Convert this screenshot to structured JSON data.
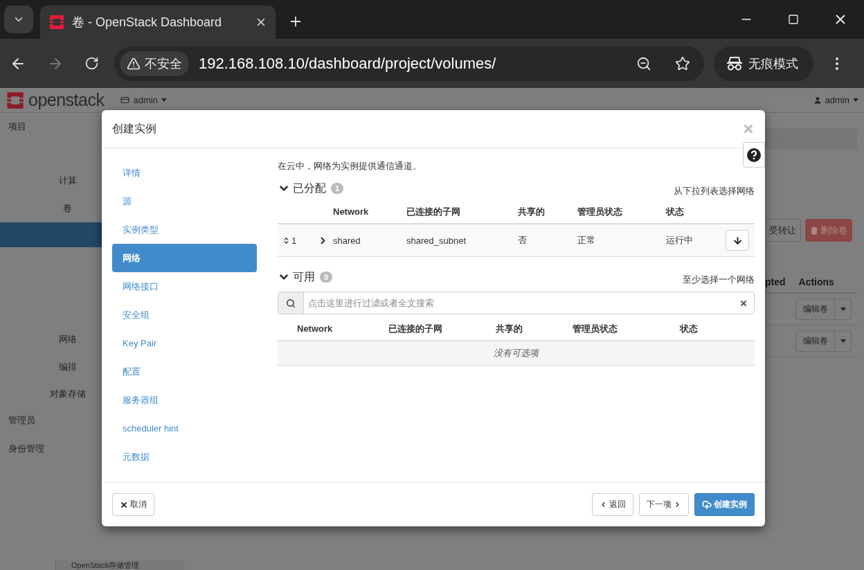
{
  "browser": {
    "tab_title": "卷 - OpenStack Dashboard",
    "security_label": "不安全",
    "url": "192.168.108.10/dashboard/project/volumes/",
    "incognito_label": "无痕模式"
  },
  "header": {
    "logo_text": "openstack",
    "project": "admin",
    "user": "admin"
  },
  "sidebar": {
    "items": [
      {
        "label": "项目",
        "kind": "section"
      },
      {
        "label": "计算",
        "kind": "sub"
      },
      {
        "label": "卷",
        "kind": "sub"
      },
      {
        "label": "网络",
        "kind": "sub"
      },
      {
        "label": "编排",
        "kind": "sub"
      },
      {
        "label": "对象存储",
        "kind": "sub"
      },
      {
        "label": "管理员",
        "kind": "section"
      },
      {
        "label": "身份管理",
        "kind": "section"
      }
    ]
  },
  "background": {
    "buttons": [
      {
        "label": "受转让",
        "kind": "default"
      },
      {
        "label": "删除卷",
        "kind": "danger"
      }
    ],
    "columns": [
      "pted",
      "Actions"
    ],
    "rows": [
      {
        "action": "编辑卷"
      },
      {
        "action": "编辑卷"
      }
    ],
    "bottom_item": "OpenStack存储管理"
  },
  "modal": {
    "title": "创建实例",
    "steps": [
      {
        "label": "详情",
        "selected": false
      },
      {
        "label": "源",
        "selected": false
      },
      {
        "label": "实例类型",
        "selected": false
      },
      {
        "label": "网络",
        "selected": true
      },
      {
        "label": "网络接口",
        "selected": false
      },
      {
        "label": "安全组",
        "selected": false
      },
      {
        "label": "Key Pair",
        "selected": false
      },
      {
        "label": "配置",
        "selected": false
      },
      {
        "label": "服务器组",
        "selected": false
      },
      {
        "label": "scheduler hint",
        "selected": false
      },
      {
        "label": "元数据",
        "selected": false
      }
    ],
    "intro": "在云中，网络为实例提供通信通道。",
    "allocated": {
      "title": "已分配",
      "count": "1",
      "hint": "从下拉列表选择网络",
      "expanded": true,
      "columns": [
        "Network",
        "已连接的子网",
        "共享的",
        "管理员状态",
        "状态"
      ],
      "rows": [
        {
          "order": "1",
          "network": "shared",
          "subnet": "shared_subnet",
          "shared": "否",
          "admin_state": "正常",
          "status": "运行中"
        }
      ]
    },
    "available": {
      "title": "可用",
      "count": "0",
      "hint": "至少选择一个网络",
      "expanded": true,
      "search_placeholder": "点击这里进行过滤或者全文搜索",
      "columns": [
        "Network",
        "已连接的子网",
        "共享的",
        "管理员状态",
        "状态"
      ],
      "empty_text": "没有可选项"
    },
    "buttons": {
      "cancel": "取消",
      "back": "返回",
      "next": "下一项",
      "create": "创建实例"
    }
  }
}
